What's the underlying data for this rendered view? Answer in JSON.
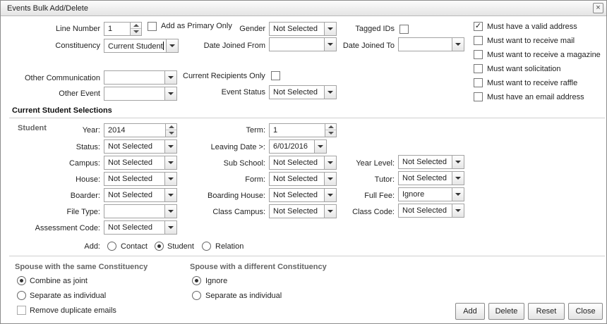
{
  "dialog": {
    "title": "Events Bulk Add/Delete",
    "close_icon": "×"
  },
  "top": {
    "line_number": {
      "label": "Line Number",
      "value": "1"
    },
    "add_as_primary_only": {
      "label": "Add as Primary Only",
      "checked": false
    },
    "gender": {
      "label": "Gender",
      "value": "Not Selected"
    },
    "tagged_ids": {
      "label": "Tagged IDs",
      "checked": false
    },
    "constituency": {
      "label": "Constituency",
      "value": "Current Student"
    },
    "date_joined_from": {
      "label": "Date Joined From",
      "value": ""
    },
    "date_joined_to": {
      "label": "Date Joined To",
      "value": ""
    },
    "other_communication": {
      "label": "Other Communication",
      "value": ""
    },
    "current_recipients_only": {
      "label": "Current Recipients Only",
      "checked": false
    },
    "other_event": {
      "label": "Other Event",
      "value": ""
    },
    "event_status": {
      "label": "Event Status",
      "value": "Not Selected"
    }
  },
  "requirements": [
    {
      "label": "Must have a valid address",
      "checked": true
    },
    {
      "label": "Must want to receive mail",
      "checked": false
    },
    {
      "label": "Must want to receive a magazine",
      "checked": false
    },
    {
      "label": "Must want solicitation",
      "checked": false
    },
    {
      "label": "Must want to receive raffle",
      "checked": false
    },
    {
      "label": "Must have an email address",
      "checked": false
    }
  ],
  "student": {
    "section_title": "Current Student Selections",
    "group_label": "Student",
    "year": {
      "label": "Year:",
      "value": "2014"
    },
    "term": {
      "label": "Term:",
      "value": "1"
    },
    "status": {
      "label": "Status:",
      "value": "Not Selected"
    },
    "leaving_date": {
      "label": "Leaving Date >:",
      "value": "6/01/2016"
    },
    "campus": {
      "label": "Campus:",
      "value": "Not Selected"
    },
    "sub_school": {
      "label": "Sub School:",
      "value": "Not Selected"
    },
    "year_level": {
      "label": "Year Level:",
      "value": "Not Selected"
    },
    "house": {
      "label": "House:",
      "value": "Not Selected"
    },
    "form": {
      "label": "Form:",
      "value": "Not Selected"
    },
    "tutor": {
      "label": "Tutor:",
      "value": "Not Selected"
    },
    "boarder": {
      "label": "Boarder:",
      "value": "Not Selected"
    },
    "boarding_house": {
      "label": "Boarding House:",
      "value": "Not Selected"
    },
    "full_fee": {
      "label": "Full Fee:",
      "value": "Ignore"
    },
    "file_type": {
      "label": "File Type:",
      "value": ""
    },
    "class_campus": {
      "label": "Class Campus:",
      "value": "Not Selected"
    },
    "class_code": {
      "label": "Class Code:",
      "value": "Not Selected"
    },
    "assessment_code": {
      "label": "Assessment Code:",
      "value": "Not Selected"
    },
    "add": {
      "label": "Add:",
      "options": [
        "Contact",
        "Student",
        "Relation"
      ],
      "selected": "Student"
    }
  },
  "spouse_same": {
    "title": "Spouse with the same Constituency",
    "options": [
      "Combine as joint",
      "Separate as individual"
    ],
    "selected": "Combine as joint",
    "remove_duplicates": {
      "label": "Remove duplicate emails",
      "checked": false
    }
  },
  "spouse_diff": {
    "title": "Spouse with a different Constituency",
    "options": [
      "Ignore",
      "Separate as individual"
    ],
    "selected": "Ignore"
  },
  "buttons": {
    "add": "Add",
    "delete": "Delete",
    "reset": "Reset",
    "close": "Close"
  }
}
